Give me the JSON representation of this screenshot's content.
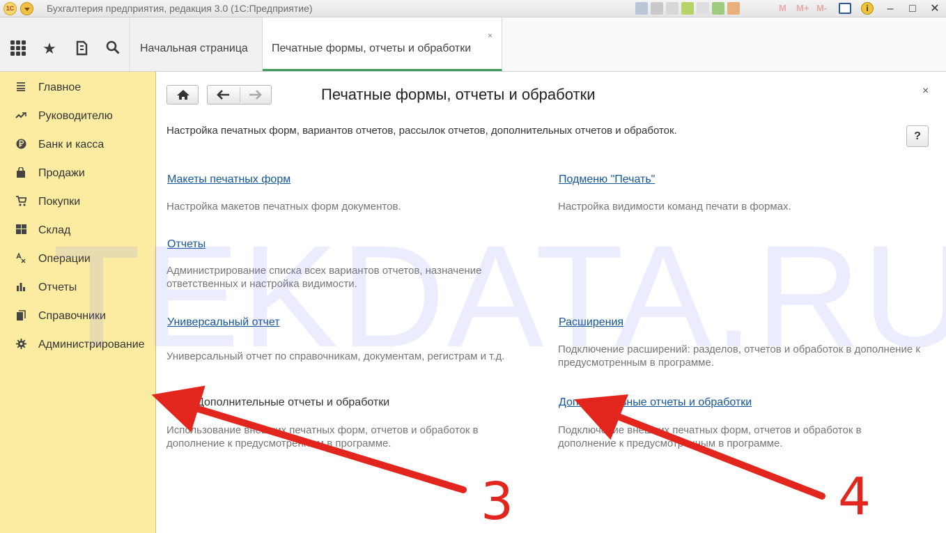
{
  "app": {
    "window_title": "Бухгалтерия предприятия, редакция 3.0  (1С:Предприятие)",
    "logo_text": "1С",
    "title_bar_markers": [
      "M",
      "M+",
      "M-"
    ],
    "window_buttons": [
      "–",
      "□",
      "✕"
    ]
  },
  "tabs": [
    {
      "label": "Начальная страница"
    },
    {
      "label": "Печатные формы, отчеты и обработки",
      "close": "×"
    }
  ],
  "sidebar": {
    "items": [
      {
        "label": "Главное",
        "icon": "menu-lines-icon"
      },
      {
        "label": "Руководителю",
        "icon": "trend-icon"
      },
      {
        "label": "Банк и касса",
        "icon": "ruble-coin-icon"
      },
      {
        "label": "Продажи",
        "icon": "shopping-bag-icon"
      },
      {
        "label": "Покупки",
        "icon": "cart-icon"
      },
      {
        "label": "Склад",
        "icon": "warehouse-grid-icon"
      },
      {
        "label": "Операции",
        "icon": "operations-icon"
      },
      {
        "label": "Отчеты",
        "icon": "bar-chart-icon"
      },
      {
        "label": "Справочники",
        "icon": "books-icon"
      },
      {
        "label": "Администрирование",
        "icon": "gear-icon"
      }
    ]
  },
  "content": {
    "title": "Печатные формы, отчеты и обработки",
    "close": "×",
    "intro": "Настройка печатных форм, вариантов отчетов, рассылок отчетов, дополнительных отчетов и обработок.",
    "help": "?",
    "sections": {
      "templates": {
        "link": "Макеты печатных форм",
        "desc": "Настройка макетов печатных форм документов."
      },
      "print_submenu": {
        "link": "Подменю \"Печать\"",
        "desc": "Настройка видимости команд печати в формах."
      },
      "reports": {
        "link": "Отчеты",
        "desc": "Администрирование списка всех вариантов отчетов, назначение ответственных и настройка видимости."
      },
      "universal": {
        "link": "Универсальный отчет",
        "desc": "Универсальный отчет по справочникам, документам, регистрам и т.д."
      },
      "extensions": {
        "link": "Расширения",
        "desc": "Подключение расширений: разделов, отчетов и обработок в дополнение к предусмотренным в программе."
      },
      "additional_toggle": {
        "label": "Дополнительные отчеты и обработки",
        "checked": true,
        "desc": "Использование внешних печатных форм, отчетов и обработок в дополнение к предусмотренным в программе."
      },
      "additional_link": {
        "link": "Дополнительные отчеты и обработки",
        "desc": "Подключение внешних печатных форм, отчетов и обработок в дополнение к предусмотренным в программе."
      }
    }
  },
  "watermark": "TEKDATA.RU",
  "annotations": {
    "marker_3": "3",
    "marker_4": "4",
    "color": "#e2261d"
  }
}
